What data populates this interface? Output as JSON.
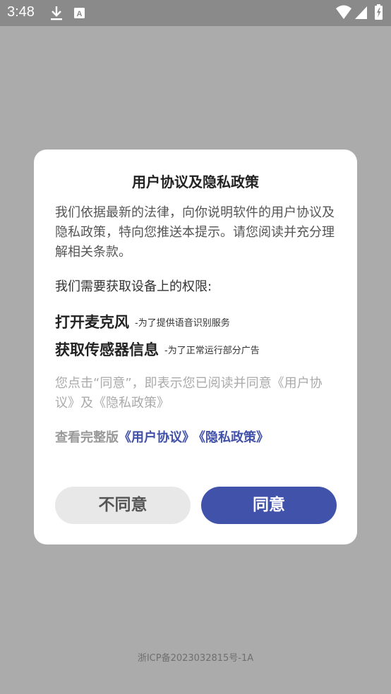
{
  "status_bar": {
    "time": "3:48",
    "icons": [
      "download-icon",
      "text-a-icon",
      "wifi-icon",
      "signal-icon",
      "battery-icon"
    ],
    "notification_letter": "A"
  },
  "dialog": {
    "title": "用户协议及隐私政策",
    "intro": "我们依据最新的法律，向你说明软件的用户协议及隐私政策，特向您推送本提示。请您阅读并充分理解相关条款。",
    "permissions_heading": "我们需要获取设备上的权限:",
    "permissions": [
      {
        "name": "打开麦克风",
        "desc": "-为了提供语音识别服务"
      },
      {
        "name": "获取传感器信息",
        "desc": "-为了正常运行部分广告"
      }
    ],
    "consent": "您点击“同意”，即表示您已阅读并同意《用户协议》及《隐私政策》",
    "links_prefix": "查看完整版",
    "user_agreement_link": "《用户协议》",
    "privacy_policy_link": "《隐私政策》",
    "disagree_label": "不同意",
    "agree_label": "同意"
  },
  "footer": {
    "icp": "浙ICP备2023032815号-1A"
  },
  "colors": {
    "overlay": "#ababab",
    "status_bar": "#8a8a8a",
    "accent": "#4152ab",
    "link": "#4150a8",
    "disagree_button": "#e8e8e8"
  }
}
